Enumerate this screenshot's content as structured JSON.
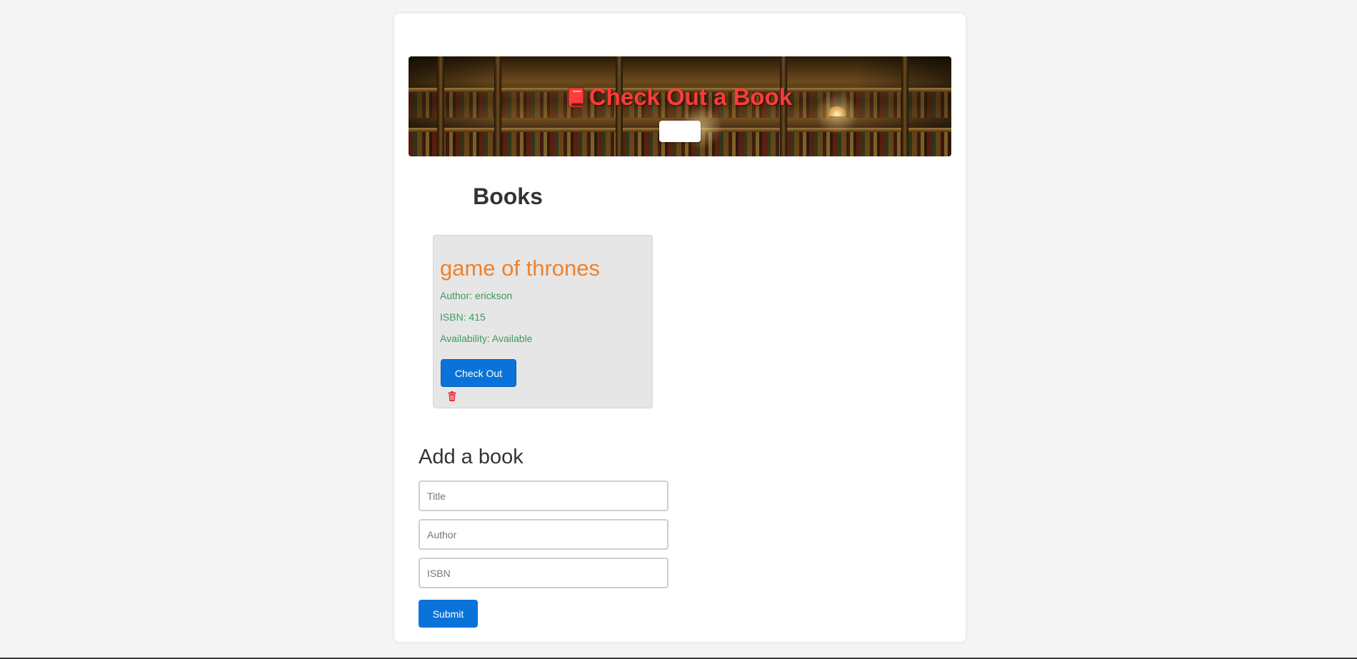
{
  "app": {
    "title": "Check Out a Book",
    "accent_color": "#0a73d9",
    "title_color": "#ff3b3b"
  },
  "banner": {
    "title_text": "Check Out a Book",
    "icon": "book-icon",
    "button_label": ""
  },
  "books": {
    "heading": "Books",
    "items": [
      {
        "title": "game of thrones",
        "author_line": "Author: erickson",
        "isbn_line": "ISBN: 415",
        "availability_line": "Availability: Available",
        "checkout_label": "Check Out",
        "delete_icon": "trash-icon"
      }
    ]
  },
  "add_book": {
    "heading": "Add a book",
    "title_placeholder": "Title",
    "author_placeholder": "Author",
    "isbn_placeholder": "ISBN",
    "title_value": "",
    "author_value": "",
    "isbn_value": "",
    "submit_label": "Submit"
  }
}
